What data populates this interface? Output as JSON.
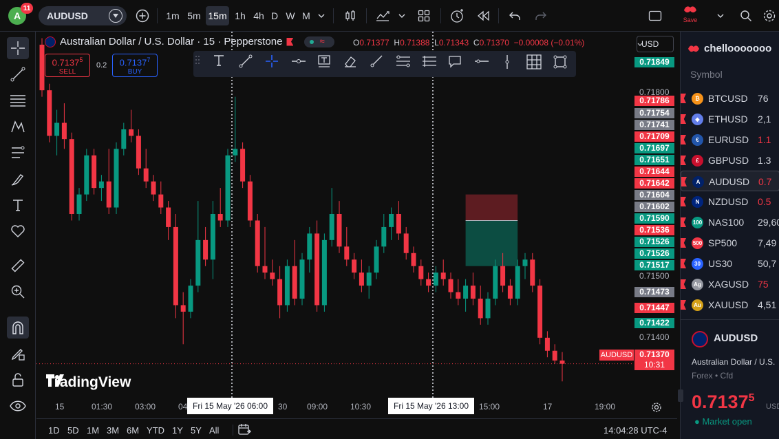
{
  "user": {
    "initial": "A",
    "notifications": "11"
  },
  "symbol": {
    "ticker": "AUDUSD"
  },
  "timeframes": [
    "1m",
    "5m",
    "15m",
    "1h",
    "4h",
    "D",
    "W",
    "M"
  ],
  "active_timeframe": "15m",
  "save_label": "Save",
  "legend": {
    "title": "Australian Dollar / U.S. Dollar · 15 · Pepperstone",
    "ohlc": {
      "o_label": "O",
      "o": "0.71377",
      "h_label": "H",
      "h": "0.71388",
      "l_label": "L",
      "l": "0.71343",
      "c_label": "C",
      "c": "0.71370",
      "change": "−0.00008 (−0.01%)"
    }
  },
  "trade": {
    "sell_price": "0.7137",
    "sell_sup": "5",
    "sell_label": "SELL",
    "spread": "0.2",
    "buy_price": "0.7137",
    "buy_sup": "7",
    "buy_label": "BUY"
  },
  "currency": "USD",
  "price_axis": {
    "ticks": [
      "0.71800",
      "0.71500",
      "0.71400"
    ],
    "labels": [
      {
        "v": "0.71849",
        "color": "#089981"
      },
      {
        "v": "0.71786",
        "color": "#f23645"
      },
      {
        "v": "0.71754",
        "color": "#787b86"
      },
      {
        "v": "0.71741",
        "color": "#787b86"
      },
      {
        "v": "0.71709",
        "color": "#f23645"
      },
      {
        "v": "0.71697",
        "color": "#089981"
      },
      {
        "v": "0.71651",
        "color": "#089981"
      },
      {
        "v": "0.71644",
        "color": "#f23645"
      },
      {
        "v": "0.71642",
        "color": "#f23645"
      },
      {
        "v": "0.71604",
        "color": "#787b86"
      },
      {
        "v": "0.71602",
        "color": "#787b86"
      },
      {
        "v": "0.71590",
        "color": "#089981"
      },
      {
        "v": "0.71536",
        "color": "#f23645"
      },
      {
        "v": "0.71526",
        "color": "#089981"
      },
      {
        "v": "0.71526",
        "color": "#089981"
      },
      {
        "v": "0.71517",
        "color": "#089981"
      },
      {
        "v": "0.71473",
        "color": "#787b86"
      },
      {
        "v": "0.71447",
        "color": "#f23645"
      },
      {
        "v": "0.71422",
        "color": "#089981"
      }
    ],
    "current_symbol": "AUDUSD",
    "current_price": "0.71370",
    "countdown": "10:31"
  },
  "time_axis": {
    "ticks": [
      "15",
      "01:30",
      "03:00",
      "04",
      "30",
      "09:00",
      "10:30",
      "15:00",
      "17",
      "19:00"
    ],
    "crosshair_1": "Fri 15 May '26   06:00",
    "crosshair_2": "Fri 15 May '26   13:00"
  },
  "brand": "TradingView",
  "ranges": [
    "1D",
    "5D",
    "1M",
    "3M",
    "6M",
    "YTD",
    "1Y",
    "5Y",
    "All"
  ],
  "clock": "14:04:28 UTC-4",
  "watchlist": {
    "name": "chellooooooo",
    "header": "Symbol",
    "items": [
      {
        "name": "BTCUSD",
        "value": "76",
        "color": "#d1d4dc",
        "icon": "bitcoin-icon",
        "icon_bg": "#f7931a",
        "icon_text": "₿"
      },
      {
        "name": "ETHUSD",
        "value": "2,1",
        "color": "#d1d4dc",
        "icon": "ethereum-icon",
        "icon_bg": "#627eea",
        "icon_text": "◆"
      },
      {
        "name": "EURUSD",
        "value": "1.1",
        "color": "#f23645",
        "icon": "eur-usd-flag-icon",
        "icon_bg": "#2255aa",
        "icon_text": "€"
      },
      {
        "name": "GBPUSD",
        "value": "1.3",
        "color": "#d1d4dc",
        "icon": "gbp-usd-flag-icon",
        "icon_bg": "#c8102e",
        "icon_text": "£"
      },
      {
        "name": "AUDUSD",
        "value": "0.7",
        "color": "#f23645",
        "icon": "aud-usd-flag-icon",
        "icon_bg": "#012169",
        "icon_text": "A"
      },
      {
        "name": "NZDUSD",
        "value": "0.5",
        "color": "#f23645",
        "icon": "nzd-usd-flag-icon",
        "icon_bg": "#00247d",
        "icon_text": "N"
      },
      {
        "name": "NAS100",
        "value": "29,60",
        "color": "#d1d4dc",
        "icon": "nas100-icon",
        "icon_bg": "#089981",
        "icon_text": "100"
      },
      {
        "name": "SP500",
        "value": "7,49",
        "color": "#d1d4dc",
        "icon": "sp500-icon",
        "icon_bg": "#f23645",
        "icon_text": "500"
      },
      {
        "name": "US30",
        "value": "50,7",
        "color": "#d1d4dc",
        "icon": "us30-icon",
        "icon_bg": "#2962ff",
        "icon_text": "30"
      },
      {
        "name": "XAGUSD",
        "value": "75",
        "color": "#f23645",
        "icon": "silver-icon",
        "icon_bg": "#9598a1",
        "icon_text": "Ag"
      },
      {
        "name": "XAUUSD",
        "value": "4,51",
        "color": "#d1d4dc",
        "icon": "gold-icon",
        "icon_bg": "#d4a017",
        "icon_text": "Au"
      }
    ],
    "selected": "AUDUSD"
  },
  "details": {
    "symbol": "AUDUSD",
    "description": "Australian Dollar / U.S.",
    "type": "Forex • Cfd",
    "price_main": "0.7137",
    "price_sup": "5",
    "currency": "USD",
    "market_status": "● Market open"
  },
  "chart_data": {
    "type": "candlestick",
    "candles": [
      [
        0.7186,
        0.7187,
        0.7178,
        0.7179
      ],
      [
        0.7179,
        0.718,
        0.7171,
        0.7172
      ],
      [
        0.7172,
        0.7176,
        0.7169,
        0.7174
      ],
      [
        0.7174,
        0.7177,
        0.717,
        0.71715
      ],
      [
        0.71715,
        0.71725,
        0.7159,
        0.716
      ],
      [
        0.716,
        0.7164,
        0.7159,
        0.7163
      ],
      [
        0.7163,
        0.717,
        0.7162,
        0.7169
      ],
      [
        0.7169,
        0.717,
        0.7163,
        0.7164
      ],
      [
        0.7164,
        0.7166,
        0.7162,
        0.7165
      ],
      [
        0.7165,
        0.717,
        0.716,
        0.7161
      ],
      [
        0.7161,
        0.7171,
        0.716,
        0.717
      ],
      [
        0.717,
        0.7174,
        0.7169,
        0.7173
      ],
      [
        0.7173,
        0.7176,
        0.7171,
        0.7172
      ],
      [
        0.7172,
        0.7173,
        0.7166,
        0.7167
      ],
      [
        0.7167,
        0.717,
        0.7164,
        0.7165
      ],
      [
        0.7165,
        0.7166,
        0.7162,
        0.7163
      ],
      [
        0.7163,
        0.7165,
        0.716,
        0.7161
      ],
      [
        0.7161,
        0.7162,
        0.7156,
        0.7158
      ],
      [
        0.7158,
        0.716,
        0.7144,
        0.7146
      ],
      [
        0.7146,
        0.7148,
        0.714,
        0.7145
      ],
      [
        0.7145,
        0.715,
        0.7144,
        0.7149
      ],
      [
        0.7149,
        0.7162,
        0.7148,
        0.7156
      ],
      [
        0.7156,
        0.7158,
        0.7152,
        0.7153
      ],
      [
        0.7153,
        0.7162,
        0.715,
        0.716
      ],
      [
        0.716,
        0.7164,
        0.7158,
        0.7159
      ],
      [
        0.7159,
        0.717,
        0.7158,
        0.7169
      ],
      [
        0.7169,
        0.7178,
        0.7168,
        0.717
      ],
      [
        0.717,
        0.7171,
        0.7164,
        0.7165
      ],
      [
        0.7165,
        0.7166,
        0.7158,
        0.7159
      ],
      [
        0.7159,
        0.716,
        0.7151,
        0.7152
      ],
      [
        0.7152,
        0.7158,
        0.715,
        0.7151
      ],
      [
        0.7151,
        0.7153,
        0.7149,
        0.715
      ],
      [
        0.715,
        0.7152,
        0.7144,
        0.7146
      ],
      [
        0.7146,
        0.7153,
        0.7145,
        0.7152
      ],
      [
        0.7152,
        0.7156,
        0.7146,
        0.7147
      ],
      [
        0.7147,
        0.7154,
        0.7146,
        0.7153
      ],
      [
        0.7153,
        0.7158,
        0.7151,
        0.7157
      ],
      [
        0.7157,
        0.7159,
        0.7145,
        0.7146
      ],
      [
        0.7146,
        0.7157,
        0.7145,
        0.7156
      ],
      [
        0.7156,
        0.7164,
        0.7155,
        0.716
      ],
      [
        0.716,
        0.7162,
        0.7154,
        0.7155
      ],
      [
        0.7155,
        0.7158,
        0.7152,
        0.7153
      ],
      [
        0.7153,
        0.7154,
        0.715,
        0.7151
      ],
      [
        0.7151,
        0.7153,
        0.7148,
        0.7149
      ],
      [
        0.7149,
        0.7152,
        0.7147,
        0.7151
      ],
      [
        0.7151,
        0.7156,
        0.715,
        0.7155
      ],
      [
        0.7155,
        0.716,
        0.7154,
        0.7158
      ],
      [
        0.7158,
        0.7161,
        0.7156,
        0.716
      ],
      [
        0.716,
        0.7162,
        0.7156,
        0.7157
      ],
      [
        0.7157,
        0.7158,
        0.7153,
        0.7154
      ],
      [
        0.7154,
        0.7155,
        0.7151,
        0.7152
      ],
      [
        0.7152,
        0.7153,
        0.7149,
        0.715
      ],
      [
        0.715,
        0.7151,
        0.7148,
        0.7149
      ],
      [
        0.7149,
        0.7152,
        0.7148,
        0.7151
      ],
      [
        0.7151,
        0.7153,
        0.7149,
        0.715
      ],
      [
        0.715,
        0.7151,
        0.7147,
        0.7148
      ],
      [
        0.7148,
        0.715,
        0.7146,
        0.7147
      ],
      [
        0.7147,
        0.715,
        0.7145,
        0.7149
      ],
      [
        0.7149,
        0.7151,
        0.7146,
        0.7147
      ],
      [
        0.7147,
        0.7149,
        0.7143,
        0.7144
      ],
      [
        0.7144,
        0.7148,
        0.7143,
        0.7147
      ],
      [
        0.7147,
        0.7153,
        0.7146,
        0.7152
      ],
      [
        0.7152,
        0.7154,
        0.7148,
        0.7149
      ],
      [
        0.7149,
        0.715,
        0.7146,
        0.7147
      ],
      [
        0.7147,
        0.7153,
        0.7146,
        0.7152
      ],
      [
        0.7152,
        0.7154,
        0.715,
        0.7153
      ],
      [
        0.7153,
        0.7154,
        0.7148,
        0.7149
      ],
      [
        0.7149,
        0.715,
        0.714,
        0.7141
      ],
      [
        0.7141,
        0.7142,
        0.7138,
        0.7139
      ],
      [
        0.7139,
        0.714,
        0.7137,
        0.71375
      ],
      [
        0.71375,
        0.71388,
        0.71343,
        0.7137
      ]
    ],
    "y_range": [
      0.7132,
      0.7188
    ],
    "position_box": {
      "entry": 0.7159,
      "stop": 0.7163,
      "target": 0.7152
    }
  }
}
